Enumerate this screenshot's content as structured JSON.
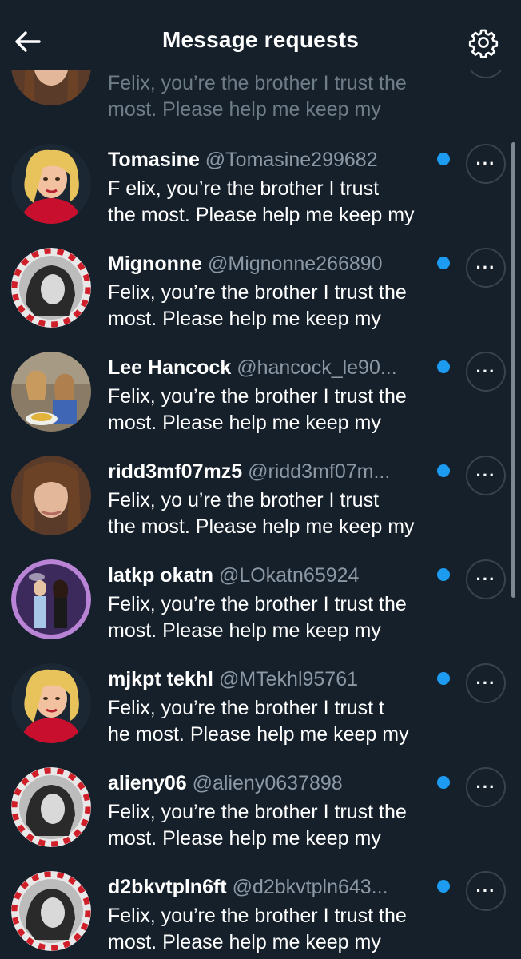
{
  "header": {
    "title": "Message requests",
    "back_icon": "arrow-left-icon",
    "settings_icon": "gear-icon"
  },
  "colors": {
    "background": "#15202b",
    "accent": "#1d9bf0",
    "secondary_text": "#8b98a5"
  },
  "partial_row": {
    "preview": "Felix, you’re the brother I trust the\nmost. Please help me keep my"
  },
  "conversations": [
    {
      "name": "Tomasine",
      "handle": "@Tomasine299682",
      "preview": "F elix, you’re the brother I trust\nthe most. Please help me keep my",
      "more_label": "···"
    },
    {
      "name": "Mignonne",
      "handle": "@Mignonne266890",
      "preview": "Felix, you’re the brother I trust the\nmost. Please help me keep my",
      "more_label": "···"
    },
    {
      "name": "Lee Hancock",
      "handle": "@hancock_le90...",
      "preview": "Felix, you’re the brother I trust the\nmost. Please help me keep my",
      "more_label": "···"
    },
    {
      "name": "ridd3mf07mz5",
      "handle": "@ridd3mf07m...",
      "preview": "Felix, yo u’re the brother I trust\nthe most. Please help me keep my",
      "more_label": "···"
    },
    {
      "name": "latkp okatn",
      "handle": "@LOkatn65924",
      "preview": "Felix, you’re the brother I trust the\nmost. Please help me keep my",
      "more_label": "···"
    },
    {
      "name": "mjkpt tekhl",
      "handle": "@MTekhl95761",
      "preview": "Felix, you’re the  brother I trust t\nhe most. Please help me keep my",
      "more_label": "···"
    },
    {
      "name": "alieny06",
      "handle": "@alieny0637898",
      "preview": "Felix, you’re the brother I trust the\nmost. Please help me keep my",
      "more_label": "···"
    },
    {
      "name": "d2bkvtpln6ft",
      "handle": "@d2bkvtpln643...",
      "preview": "Felix, you’re the brother I trust the\nmost. Please help me keep my",
      "more_label": "···"
    }
  ]
}
